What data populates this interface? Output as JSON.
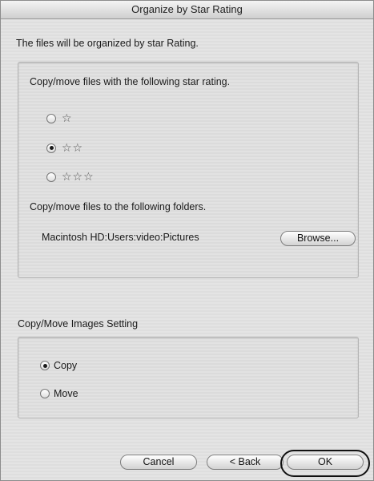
{
  "window": {
    "title": "Organize by Star Rating"
  },
  "intro": "The files will be organized by star Rating.",
  "rating_group": {
    "heading": "Copy/move files with the following star rating.",
    "options": [
      {
        "stars": "☆",
        "checked": false
      },
      {
        "stars": "☆☆",
        "checked": true
      },
      {
        "stars": "☆☆☆",
        "checked": false
      }
    ],
    "folder_heading": "Copy/move files to the following folders.",
    "folder_path": "Macintosh HD:Users:video:Pictures",
    "browse_label": "Browse..."
  },
  "mode_heading": "Copy/Move Images Setting",
  "mode_group": {
    "options": [
      {
        "label": "Copy",
        "checked": true
      },
      {
        "label": "Move",
        "checked": false
      }
    ]
  },
  "buttons": {
    "cancel": "Cancel",
    "back": "< Back",
    "ok": "OK"
  }
}
